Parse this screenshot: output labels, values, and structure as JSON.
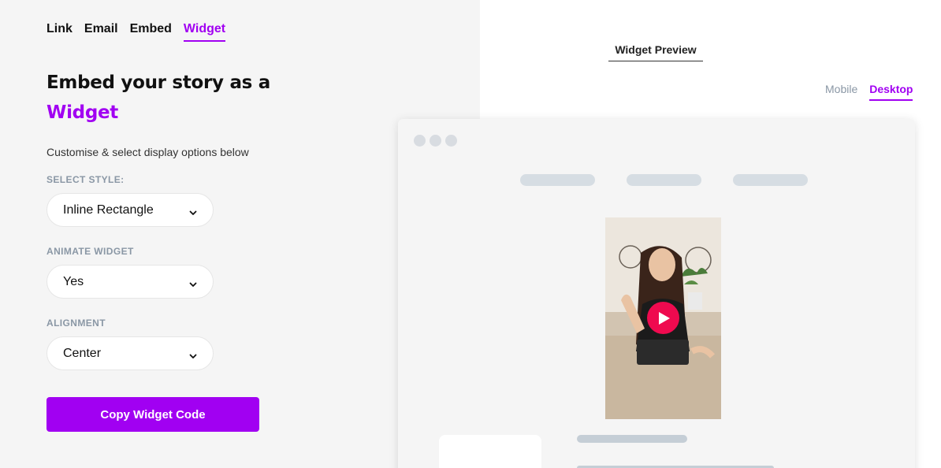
{
  "tabs": [
    {
      "label": "Link",
      "active": false
    },
    {
      "label": "Email",
      "active": false
    },
    {
      "label": "Embed",
      "active": false
    },
    {
      "label": "Widget",
      "active": true
    }
  ],
  "headline": {
    "prefix": "Embed your story as a ",
    "accent": "Widget"
  },
  "subtitle": "Customise & select display options below",
  "fields": {
    "style": {
      "label": "SELECT STYLE:",
      "value": "Inline Rectangle"
    },
    "animate": {
      "label": "ANIMATE WIDGET",
      "value": "Yes"
    },
    "alignment": {
      "label": "ALIGNMENT",
      "value": "Center"
    }
  },
  "copy_button": "Copy Widget Code",
  "preview": {
    "title": "Widget Preview",
    "device_tabs": [
      {
        "label": "Mobile",
        "active": false
      },
      {
        "label": "Desktop",
        "active": true
      }
    ]
  },
  "colors": {
    "accent": "#a100f2",
    "play": "#ef0a4f"
  },
  "icons": {
    "chevron": "chevron-down-icon",
    "play": "play-icon"
  }
}
